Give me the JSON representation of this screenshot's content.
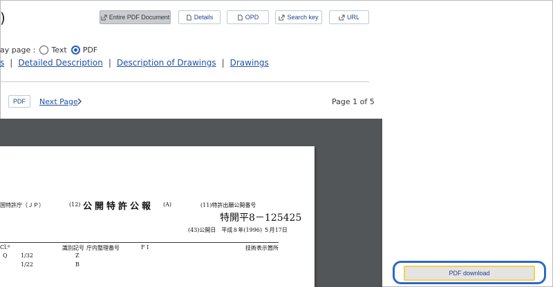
{
  "header": {
    "title_fragment": ")",
    "buttons": [
      {
        "label": "Entire PDF Document",
        "icon": "external-link-icon",
        "active": true
      },
      {
        "label": "Details",
        "icon": "document-icon",
        "active": false
      },
      {
        "label": "OPD",
        "icon": "document-icon",
        "active": false
      },
      {
        "label": "Search key",
        "icon": "external-link-icon",
        "active": false
      },
      {
        "label": "URL",
        "icon": "external-link-icon",
        "active": false
      }
    ]
  },
  "display": {
    "label": "ay page :",
    "options": [
      "Text",
      "PDF"
    ],
    "selected": "PDF"
  },
  "links": {
    "first_fragment": "s",
    "items": [
      "Detailed Description",
      "Description of Drawings",
      "Drawings"
    ]
  },
  "pager": {
    "pdf_button": "PDF",
    "next_label": "Next Page",
    "page_info": "Page 1 of 5"
  },
  "document": {
    "office": "国特許庁（ＪＰ）",
    "kind_num": "(12)",
    "kind_title": "公開特許公報",
    "kind_code": "(A)",
    "pub_num_label": "(11)特許出願公開番号",
    "pub_number": "特開平8－125425",
    "pub_date": "(43)公開日　平成８年(1996) ５月17日",
    "col_cl": "Cl.⁶",
    "col_id": "識別記号",
    "col_office": "庁内整理番号",
    "col_fi": "F I",
    "col_tech": "技術表示箇所",
    "row1_a": "Q",
    "row1_b": "1/32",
    "row1_c": "Z",
    "row2_b": "1/22",
    "row2_c": "B"
  },
  "download": {
    "label": "PDF download"
  },
  "colors": {
    "link": "#1f4fa7",
    "viewer_bg": "#525659",
    "highlight": "#2b67c9",
    "focus": "#f2d24c"
  }
}
